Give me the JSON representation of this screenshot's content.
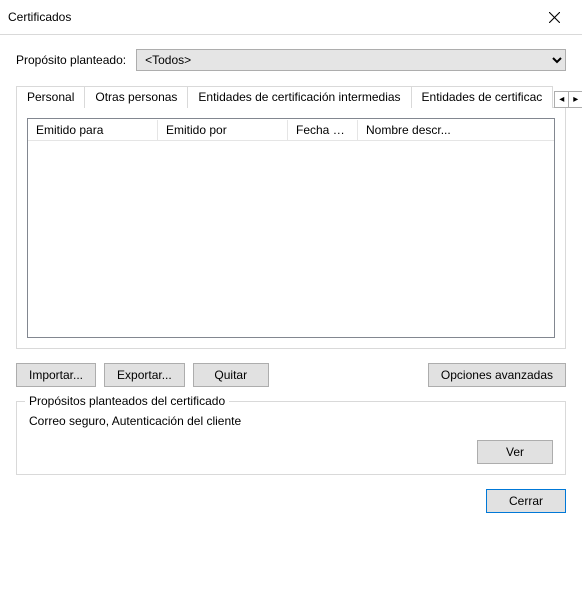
{
  "window": {
    "title": "Certificados"
  },
  "purpose": {
    "label": "Propósito planteado:",
    "selected": "<Todos>",
    "options": [
      "<Todos>"
    ]
  },
  "tabs": {
    "items": [
      {
        "label": "Personal"
      },
      {
        "label": "Otras personas"
      },
      {
        "label": "Entidades de certificación intermedias"
      },
      {
        "label": "Entidades de certificac"
      }
    ],
    "nav_left": "◂",
    "nav_right": "▸"
  },
  "list": {
    "columns": {
      "c1": "Emitido para",
      "c2": "Emitido por",
      "c3": "Fecha d...",
      "c4": "Nombre descr..."
    },
    "rows": []
  },
  "buttons": {
    "import": "Importar...",
    "export": "Exportar...",
    "remove": "Quitar",
    "advanced": "Opciones avanzadas"
  },
  "group": {
    "title": "Propósitos planteados del certificado",
    "body": "Correo seguro, Autenticación del cliente",
    "view": "Ver"
  },
  "footer": {
    "close": "Cerrar"
  }
}
